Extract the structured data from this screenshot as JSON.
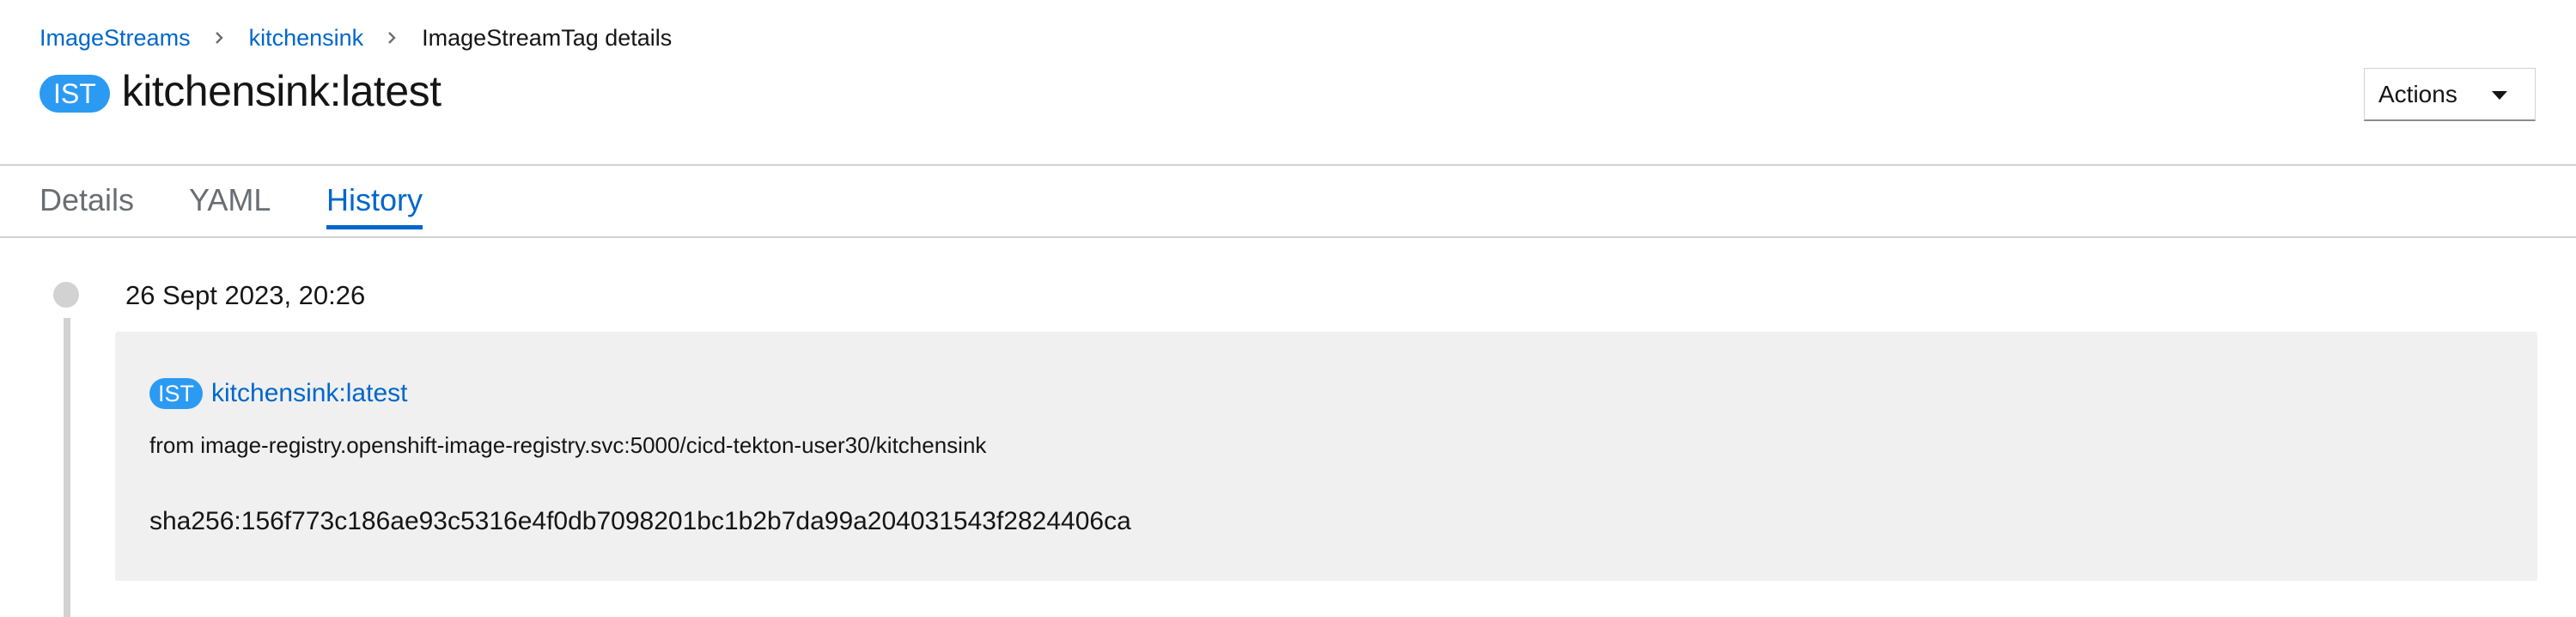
{
  "breadcrumb": {
    "items": [
      {
        "label": "ImageStreams"
      },
      {
        "label": "kitchensink"
      },
      {
        "label": "ImageStreamTag details"
      }
    ]
  },
  "header": {
    "badge": "IST",
    "title": "kitchensink:latest",
    "actions_label": "Actions"
  },
  "tabs": [
    {
      "label": "Details",
      "active": false
    },
    {
      "label": "YAML",
      "active": false
    },
    {
      "label": "History",
      "active": true
    }
  ],
  "history": [
    {
      "date": "26 Sept 2023, 20:26",
      "badge": "IST",
      "tag": "kitchensink:latest",
      "from": "from image-registry.openshift-image-registry.svc:5000/cicd-tekton-user30/kitchensink",
      "digest": "sha256:156f773c186ae93c5316e4f0db7098201bc1b2b7da99a204031543f2824406ca"
    }
  ],
  "colors": {
    "link": "#0066cc",
    "badge": "#2b9af3",
    "card_background": "#f0f0f0",
    "divider": "#d2d2d2"
  },
  "icons": {
    "breadcrumb_separator": "chevron-right-icon",
    "actions_toggle": "caret-down-icon"
  }
}
